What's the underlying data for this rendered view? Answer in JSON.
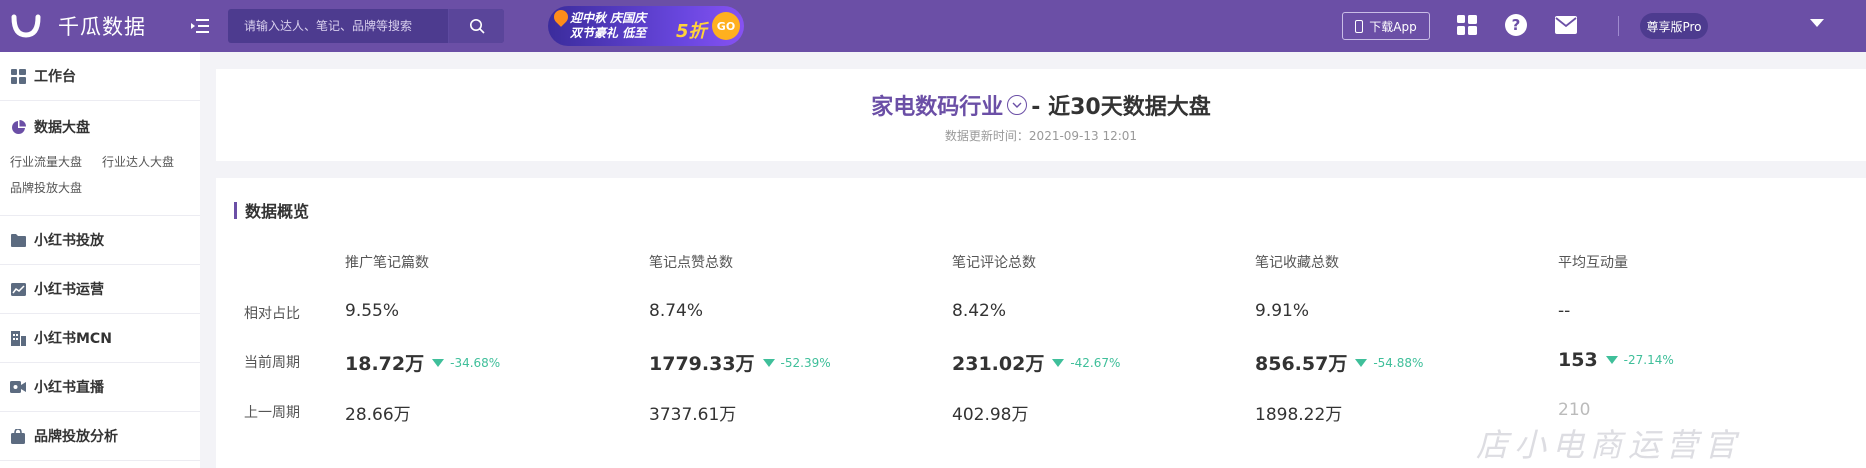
{
  "app": {
    "name": "千瓜数据"
  },
  "search": {
    "placeholder": "请输入达人、笔记、品牌等搜索"
  },
  "promo": {
    "line1": "迎中秋 庆国庆",
    "line2": "双节豪礼 低至",
    "num": "5折",
    "go": "GO"
  },
  "topbar": {
    "download_app": "下载App",
    "help": "?",
    "tier": "尊享版Pro"
  },
  "sidebar": {
    "items": [
      {
        "label": "工作台",
        "icon": "dashboard-icon"
      },
      {
        "label": "数据大盘",
        "icon": "pie-chart-icon",
        "sub": [
          "行业流量大盘",
          "行业达人大盘",
          "品牌投放大盘"
        ]
      },
      {
        "label": "小红书投放",
        "icon": "folder-icon"
      },
      {
        "label": "小红书运营",
        "icon": "trend-icon"
      },
      {
        "label": "小红书MCN",
        "icon": "building-icon"
      },
      {
        "label": "小红书直播",
        "icon": "video-icon"
      },
      {
        "label": "品牌投放分析",
        "icon": "bag-icon"
      }
    ]
  },
  "header": {
    "industry": "家电数码行业",
    "title_rest": "- 近30天数据大盘",
    "updated": "数据更新时间：2021-09-13 12:01"
  },
  "overview": {
    "title": "数据概览",
    "columns": [
      "推广笔记篇数",
      "笔记点赞总数",
      "笔记评论总数",
      "笔记收藏总数",
      "平均互动量"
    ],
    "row_labels": [
      "相对占比",
      "当前周期",
      "上一周期"
    ],
    "ratio": [
      "9.55%",
      "8.74%",
      "8.42%",
      "9.91%",
      "--"
    ],
    "current": [
      {
        "value": "18.72万",
        "change": "-34.68%"
      },
      {
        "value": "1779.33万",
        "change": "-52.39%"
      },
      {
        "value": "231.02万",
        "change": "-42.67%"
      },
      {
        "value": "856.57万",
        "change": "-54.88%"
      },
      {
        "value": "153",
        "change": "-27.14%"
      }
    ],
    "previous": [
      "28.66万",
      "3737.61万",
      "402.98万",
      "1898.22万",
      "210"
    ]
  },
  "watermark": "店小电商运营官",
  "colors": {
    "brand": "#6b4fa6",
    "down": "#3fbf9a"
  }
}
